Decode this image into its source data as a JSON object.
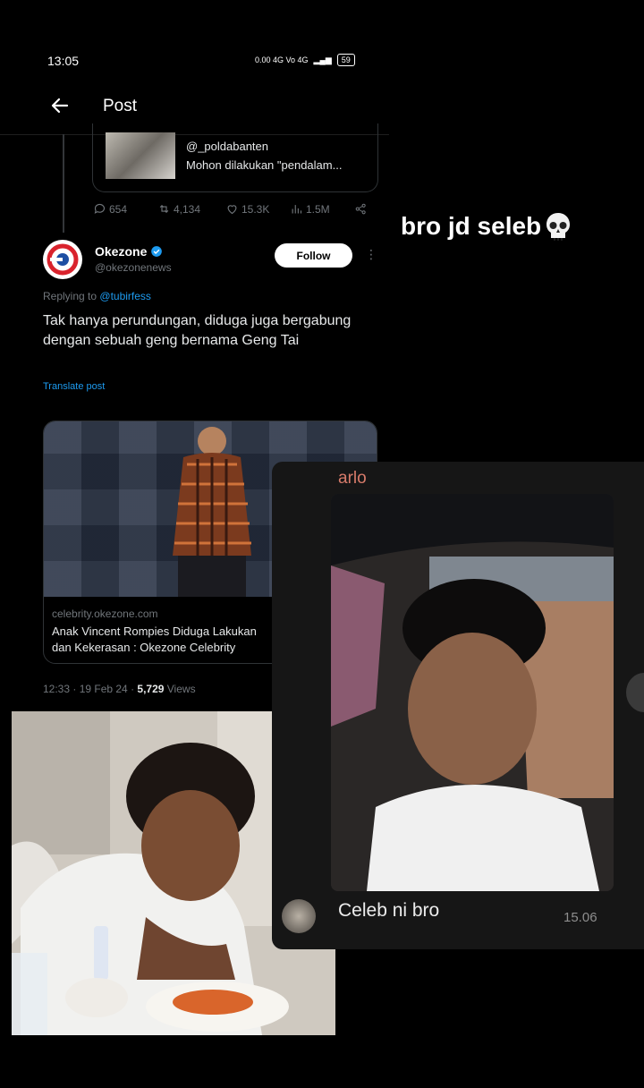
{
  "status_bar": {
    "time": "13:05",
    "network_text": "0.00 4G Vo 4G",
    "battery": "59"
  },
  "topbar": {
    "title": "Post"
  },
  "quoted_tweet": {
    "handle": "@_poldabanten",
    "text": "Mohon dilakukan \"pendalam..."
  },
  "actions": {
    "replies": "654",
    "retweets": "4,134",
    "likes": "15.3K",
    "views": "1.5M"
  },
  "tweet": {
    "author_name": "Okezone",
    "author_handle": "@okezonenews",
    "follow_label": "Follow",
    "replying_prefix": "Replying to",
    "replying_to": "@tubirfess",
    "text": "Tak hanya perundungan, diduga juga bergabung dengan sebuah geng bernama Geng Tai",
    "translate_label": "Translate post",
    "link_domain": "celebrity.okezone.com",
    "link_title_line1": "Anak Vincent Rompies Diduga Lakukan",
    "link_title_line2": "dan Kekerasan : Okezone Celebrity",
    "timestamp": "12:33 · 19 Feb 24 · ",
    "views_count": "5,729",
    "views_label": " Views"
  },
  "caption": {
    "text": "bro jd seleb"
  },
  "chat": {
    "sender": "arlo",
    "message": "Celeb ni bro",
    "time": "15.06"
  },
  "colors": {
    "accent_blue": "#1d9bf0",
    "sender_color": "#d77b6a",
    "background": "#000000"
  }
}
